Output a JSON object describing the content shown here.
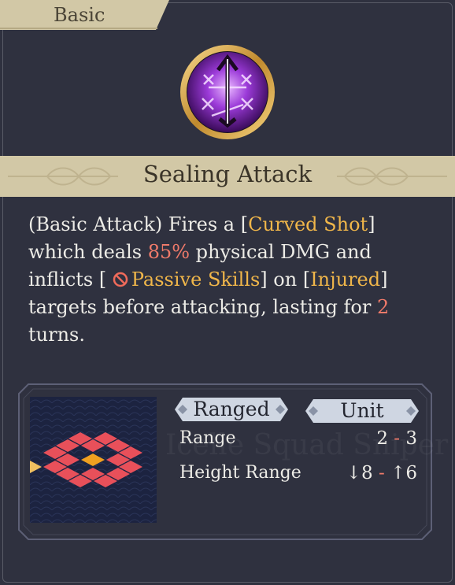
{
  "skill": {
    "category": "Basic",
    "name": "Sealing Attack",
    "icon": "arrow-rune-emblem-icon",
    "description": {
      "prefix": "(Basic Attack) Fires a ",
      "curved_shot": "Curved Shot",
      "deals_text": " which deals ",
      "damage_pct": "85%",
      "dmg_text": " physical DMG and inflicts ",
      "status_icon": "prohibited-icon",
      "passive_skills": "Passive Skills",
      "on_text": " on ",
      "injured": "Injured",
      "targets_text": " targets before attacking, lasting for ",
      "turns_value": "2",
      "turns_text": " turns."
    }
  },
  "attack_info": {
    "type_label": "Ranged",
    "target_label": "Unit",
    "watermark": "Icelle Squad Sniper",
    "stats": [
      {
        "label": "Range",
        "low": "2",
        "sep": "-",
        "high": "3"
      },
      {
        "label": "Height Range",
        "low": "↓8",
        "sep": "-",
        "high": "↑6"
      }
    ],
    "pattern": {
      "rows": 6,
      "cols": 6,
      "colors": {
        "range": "#e8505a",
        "center": "#f0a020",
        "extra": "#f0c060",
        "background": "#1c2340"
      }
    }
  }
}
